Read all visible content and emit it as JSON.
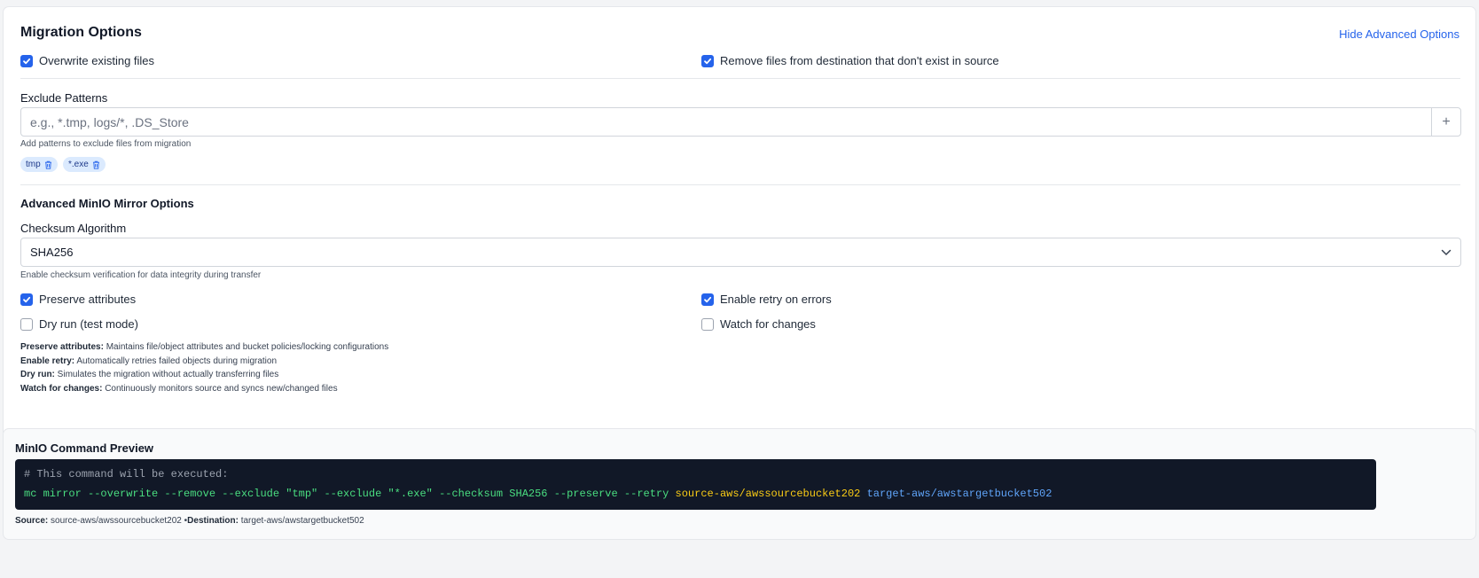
{
  "migration_options": {
    "title": "Migration Options",
    "hide_link": "Hide Advanced Options",
    "overwrite_label": "Overwrite existing files",
    "overwrite_checked": true,
    "remove_label": "Remove files from destination that don't exist in source",
    "remove_checked": true
  },
  "exclude": {
    "label": "Exclude Patterns",
    "placeholder": "e.g., *.tmp, logs/*, .DS_Store",
    "add_symbol": "+",
    "help": "Add patterns to exclude files from migration",
    "tags": [
      "tmp",
      "*.exe"
    ]
  },
  "advanced": {
    "title": "Advanced MinIO Mirror Options",
    "checksum_label": "Checksum Algorithm",
    "checksum_value": "SHA256",
    "checksum_help": "Enable checksum verification for data integrity during transfer",
    "preserve_label": "Preserve attributes",
    "preserve_checked": true,
    "retry_label": "Enable retry on errors",
    "retry_checked": true,
    "dryrun_label": "Dry run (test mode)",
    "dryrun_checked": false,
    "watch_label": "Watch for changes",
    "watch_checked": false,
    "descriptions": [
      {
        "term": "Preserve attributes:",
        "text": " Maintains file/object attributes and bucket policies/locking configurations"
      },
      {
        "term": "Enable retry:",
        "text": " Automatically retries failed objects during migration"
      },
      {
        "term": "Dry run:",
        "text": " Simulates the migration without actually transferring files"
      },
      {
        "term": "Watch for changes:",
        "text": " Continuously monitors source and syncs new/changed files"
      }
    ]
  },
  "preview": {
    "title": "MinIO Command Preview",
    "comment": "# This command will be executed:",
    "command": "mc mirror --overwrite --remove --exclude \"tmp\" --exclude \"*.exe\" --checksum SHA256 --preserve --retry",
    "source": "source-aws/awssourcebucket202",
    "target": "target-aws/awstargetbucket502",
    "footer_source_label": "Source:",
    "footer_source_value": " source-aws/awssourcebucket202",
    "footer_sep": " •",
    "footer_dest_label": "Destination:",
    "footer_dest_value": " target-aws/awstargetbucket502"
  },
  "colors": {
    "accent": "#2563eb",
    "terminal_bg": "#111827",
    "cmd_green": "#4ade80",
    "src_yellow": "#facc15",
    "dst_blue": "#60a5fa"
  }
}
